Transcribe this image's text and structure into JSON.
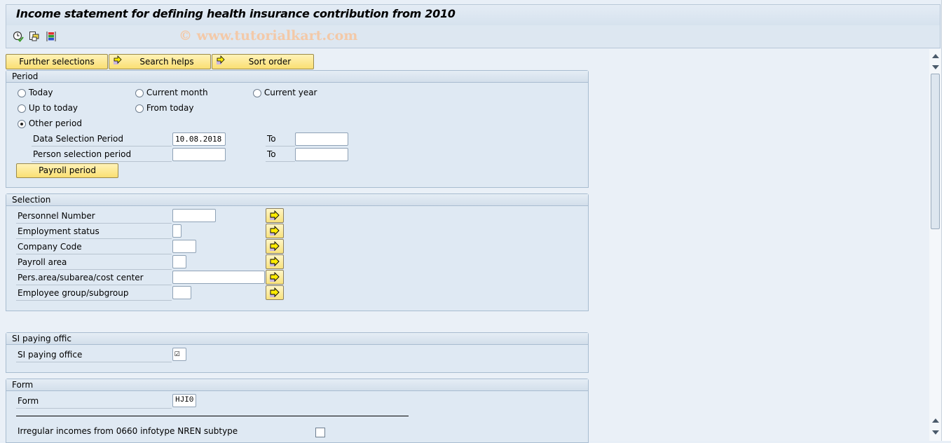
{
  "window": {
    "title": "Income statement for defining health insurance contribution from 2010",
    "watermark": "© www.tutorialkart.com"
  },
  "toolbar": {
    "icons": [
      "execute-clock-icon",
      "variants-icon",
      "selection-options-icon"
    ]
  },
  "top_buttons": {
    "further_selections": "Further selections",
    "search_helps": "Search helps",
    "sort_order": "Sort order"
  },
  "period": {
    "title": "Period",
    "radios": {
      "today": "Today",
      "current_month": "Current month",
      "current_year": "Current year",
      "up_to_today": "Up to today",
      "from_today": "From today",
      "other_period": "Other period"
    },
    "selected": "other_period",
    "data_selection_label": "Data Selection Period",
    "data_selection_from": "10.08.2018",
    "data_selection_to": "",
    "person_selection_label": "Person selection period",
    "person_selection_from": "",
    "person_selection_to": "",
    "to_label": "To",
    "payroll_period_button": "Payroll period"
  },
  "selection": {
    "title": "Selection",
    "fields": [
      {
        "label": "Personnel Number",
        "value": ""
      },
      {
        "label": "Employment status",
        "value": ""
      },
      {
        "label": "Company Code",
        "value": ""
      },
      {
        "label": "Payroll area",
        "value": ""
      },
      {
        "label": "Pers.area/subarea/cost center",
        "value": ""
      },
      {
        "label": "Employee group/subgroup",
        "value": ""
      }
    ]
  },
  "si_office": {
    "title": "SI paying offic",
    "label": "SI paying office",
    "checked": true,
    "check_glyph": "☑"
  },
  "form": {
    "title": "Form",
    "label": "Form",
    "value": "HJI0",
    "irregular_label": "Irregular incomes from 0660 infotype NREN subtype",
    "irregular_checked": false
  }
}
